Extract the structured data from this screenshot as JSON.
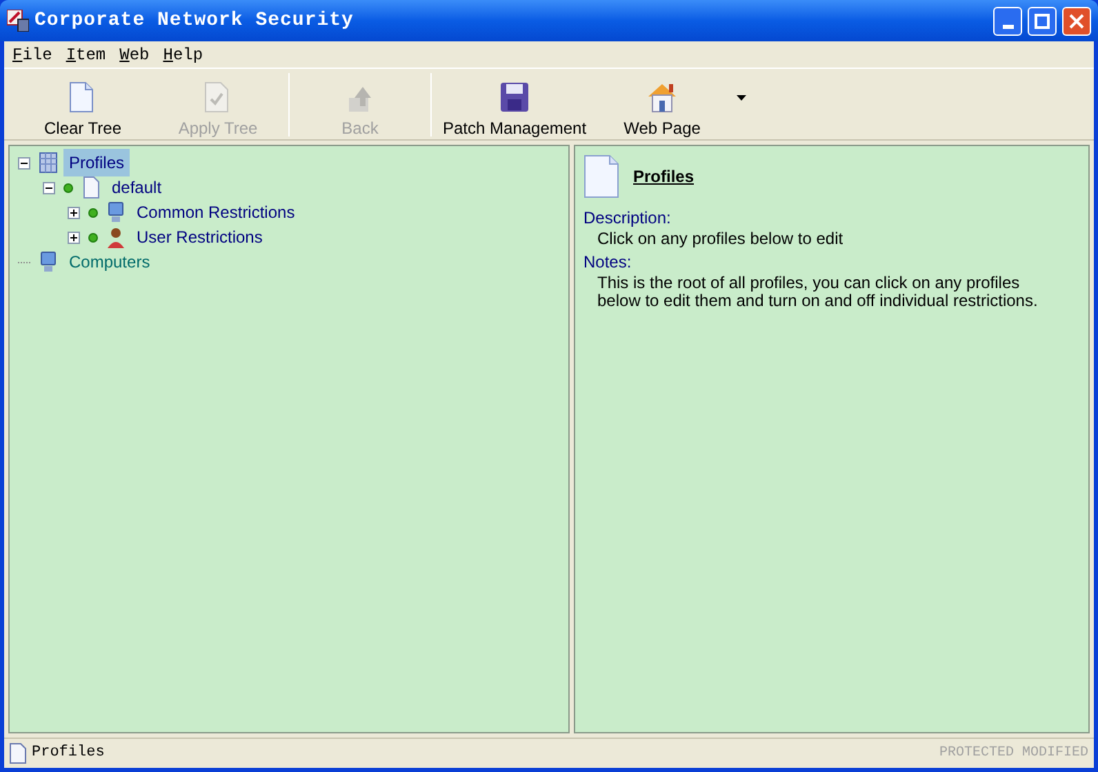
{
  "window": {
    "title": "Corporate Network Security"
  },
  "menu": [
    "File",
    "Item",
    "Web",
    "Help"
  ],
  "toolbar": [
    {
      "label": "Clear Tree",
      "kind": "page",
      "disabled": false
    },
    {
      "label": "Apply Tree",
      "kind": "check",
      "disabled": true
    },
    {
      "label": "Back",
      "kind": "back",
      "disabled": true
    },
    {
      "label": "Patch Management",
      "kind": "disk",
      "disabled": false
    },
    {
      "label": "Web Page",
      "kind": "home",
      "disabled": false
    }
  ],
  "tree": [
    {
      "label": "Profiles",
      "kind": "profiles",
      "dot": false,
      "selected": true,
      "color": "#000080",
      "expanded": true,
      "children": [
        {
          "label": "default",
          "kind": "page",
          "dot": true,
          "selected": false,
          "color": "#000080",
          "expanded": true,
          "children": [
            {
              "label": "Common Restrictions",
              "kind": "computer",
              "dot": true,
              "selected": false,
              "color": "#000080",
              "expanded": false
            },
            {
              "label": "User Restrictions",
              "kind": "user",
              "dot": true,
              "selected": false,
              "color": "#000080",
              "expanded": false
            }
          ]
        }
      ]
    },
    {
      "label": "Computers",
      "kind": "computer",
      "dot": false,
      "selected": false,
      "color": "#006a6a"
    }
  ],
  "detail": {
    "title": "Profiles",
    "sections": [
      {
        "heading": "Description:",
        "text": "Click on any profiles below to edit"
      },
      {
        "heading": "Notes:",
        "text": "This is the root of all profiles, you can click on any profiles below to edit them and turn on and off individual restrictions."
      }
    ]
  },
  "status_bar": {
    "text": "Profiles",
    "panels": [
      "PROTECTED",
      "MODIFIED"
    ]
  }
}
